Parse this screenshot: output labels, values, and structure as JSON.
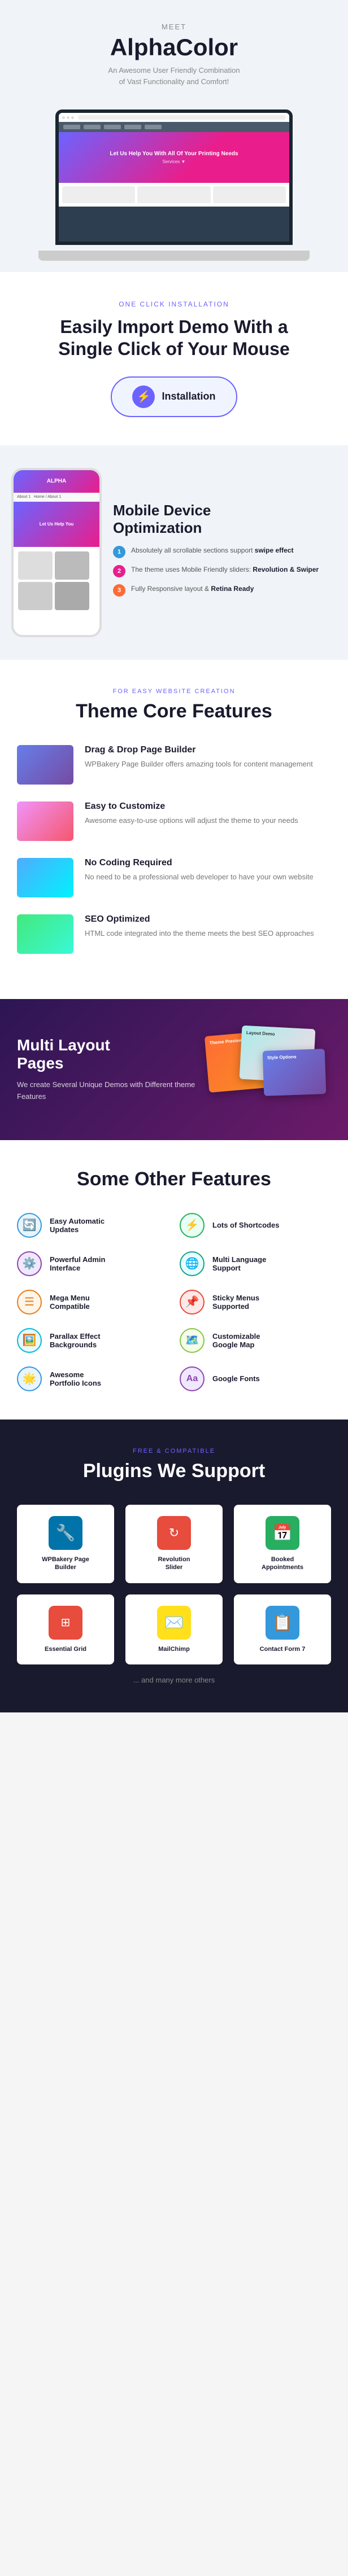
{
  "meet": {
    "label": "Meet",
    "title": "AlphaColor",
    "subtitle": "An Awesome User Friendly Combination\nof Vast Functionality and Comfort!"
  },
  "install": {
    "label": "One Click Installation",
    "title": "Easily Import Demo With a\nSingle Click of Your Mouse",
    "button": "Installation"
  },
  "mobile": {
    "title": "Mobile Device\nOptimization",
    "features": [
      {
        "num": "1",
        "text": "Absolutely all scrollable sections support ",
        "bold": "swipe effect"
      },
      {
        "num": "2",
        "text": "The theme uses Mobile Friendly sliders: ",
        "bold": "Revolution & Swiper"
      },
      {
        "num": "3",
        "text": "Fully Responsive layout & ",
        "bold": "Retina Ready"
      }
    ]
  },
  "theme_features": {
    "label": "For Easy Website Creation",
    "title": "Theme Core Features",
    "items": [
      {
        "title": "Drag & Drop Page Builder",
        "desc": "WPBakery Page Builder offers amazing tools for content management"
      },
      {
        "title": "Easy to Customize",
        "desc": "Awesome easy-to-use options will adjust the theme to your needs"
      },
      {
        "title": "No Coding Required",
        "desc": "No need to be a professional web developer to have your own website"
      },
      {
        "title": "SEO Optimized",
        "desc": "HTML code integrated into the theme meets the best SEO approaches"
      }
    ]
  },
  "multi": {
    "title": "Multi Layout\nPages",
    "desc": "We create Several Unique Demos with Different theme Features"
  },
  "other_features": {
    "title": "Some Other Features",
    "items": [
      {
        "icon": "🔄",
        "label": "Easy Automatic Updates",
        "color": "icon-blue"
      },
      {
        "icon": "⚡",
        "label": "Lots of Shortcodes",
        "color": "icon-green"
      },
      {
        "icon": "⚙️",
        "label": "Powerful Admin Interface",
        "color": "icon-purple"
      },
      {
        "icon": "🌐",
        "label": "Multi Language Support",
        "color": "icon-teal"
      },
      {
        "icon": "☰",
        "label": "Mega Menu Compatible",
        "color": "icon-orange"
      },
      {
        "icon": "📌",
        "label": "Sticky Menus Supported",
        "color": "icon-red"
      },
      {
        "icon": "🖼️",
        "label": "Parallax Effect Backgrounds",
        "color": "icon-cyan"
      },
      {
        "icon": "🗺️",
        "label": "Customizable Google Map",
        "color": "icon-lime"
      },
      {
        "icon": "🌟",
        "label": "Awesome Portfolio Icons",
        "color": "icon-blue"
      },
      {
        "icon": "🔤",
        "label": "Google Fonts",
        "color": "icon-purple"
      }
    ]
  },
  "plugins": {
    "label": "Free & Compatible",
    "title": "Plugins We Support",
    "items": [
      {
        "name": "WPBakery Page\nBuilder",
        "icon": "🔧",
        "class": "pi-wpbakery"
      },
      {
        "name": "Revolution\nSlider",
        "icon": "🔴",
        "class": "pi-revolution"
      },
      {
        "name": "Booked\nAppointments",
        "icon": "📅",
        "class": "pi-booked"
      },
      {
        "name": "Essential Grid",
        "icon": "⊞",
        "class": "pi-essential"
      },
      {
        "name": "MailChimp",
        "icon": "✉️",
        "class": "pi-mailchimp"
      },
      {
        "name": "Contact Form 7",
        "icon": "📋",
        "class": "pi-contact"
      }
    ],
    "more": "... and many more others"
  }
}
